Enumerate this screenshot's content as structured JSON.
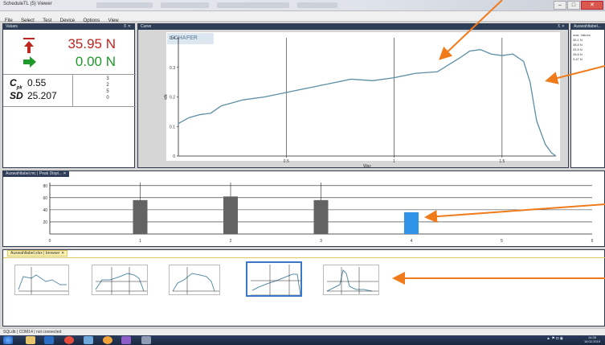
{
  "window": {
    "title": "ScheduleTL (5) Viewer"
  },
  "menu": [
    "File",
    "Select",
    "Test",
    "Device",
    "Options",
    "View"
  ],
  "values_panel": {
    "title": "Values",
    "max_value": "35.95 N",
    "current_value": "0.00 N",
    "cpk_label": "C",
    "cpk_sub": "pk",
    "cpk_value": "0.55",
    "sd_label": "SD",
    "sd_value": "25.207",
    "counts": [
      "3",
      "2",
      "5",
      "0"
    ]
  },
  "curve_panel": {
    "title": "Curve",
    "logo_text": "SCHAFER",
    "ylabel": "kN",
    "xlabel": "Way"
  },
  "results_panel": {
    "title": "Auswahltabel...",
    "header": "max. Values",
    "rows": [
      "35.1 N",
      "38.8 N",
      "33.9 N",
      "28.8 N",
      "3.47 N"
    ]
  },
  "bar_panel": {
    "tab": "Auswahltabel.mc | Peak Displ..."
  },
  "browser_panel": {
    "tab": "Auswahltabel.xlsx | browser"
  },
  "status": {
    "text": "SQLdb | COM14 | not connected"
  },
  "taskbar": {
    "clock_time": "14:26",
    "clock_date": "18.02.2019"
  },
  "colors": {
    "accent": "#3a77c7",
    "curve": "#5b8fa6",
    "bar_gray": "#636363",
    "bar_highlight": "#2f93ea",
    "arrow": "#f07b1b",
    "red": "#c0251f",
    "green": "#1e9a2a"
  },
  "chart_data": [
    {
      "type": "line",
      "title": "",
      "xlabel": "Way",
      "ylabel": "kN",
      "xlim": [
        0,
        1.75
      ],
      "ylim": [
        0,
        0.4
      ],
      "x_ticks": [
        "0.5",
        "1",
        "1.5"
      ],
      "y_ticks": [
        "0",
        "0.1",
        "0.2",
        "0.3",
        "0.4"
      ],
      "series": [
        {
          "x": [
            0.0,
            0.05,
            0.1,
            0.15,
            0.2,
            0.25,
            0.3,
            0.4,
            0.5,
            0.6,
            0.7,
            0.8,
            0.9,
            1.0,
            1.1,
            1.2,
            1.3,
            1.35,
            1.4,
            1.45,
            1.5,
            1.55,
            1.6,
            1.63,
            1.66,
            1.7,
            1.73,
            1.75
          ],
          "y": [
            0.11,
            0.13,
            0.14,
            0.145,
            0.17,
            0.18,
            0.19,
            0.2,
            0.215,
            0.23,
            0.245,
            0.26,
            0.255,
            0.265,
            0.28,
            0.285,
            0.33,
            0.355,
            0.36,
            0.345,
            0.34,
            0.345,
            0.32,
            0.25,
            0.12,
            0.04,
            0.01,
            0.0
          ]
        }
      ]
    },
    {
      "type": "bar",
      "title": "",
      "categories": [
        "1",
        "2",
        "3",
        "4"
      ],
      "values": [
        56,
        62,
        56,
        36
      ],
      "x_ticks": [
        "0",
        "1",
        "2",
        "3",
        "4",
        "5",
        "6"
      ],
      "y_ticks": [
        "20",
        "40",
        "60",
        "80"
      ],
      "ylim": [
        0,
        85
      ],
      "highlighted_category": "4"
    }
  ]
}
